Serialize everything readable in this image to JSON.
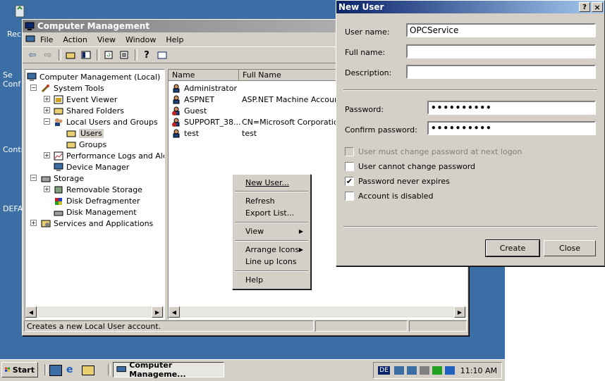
{
  "desktop": {
    "icons": [
      "Rec",
      "Se Conf",
      "Contr",
      "DEFA"
    ]
  },
  "cm_window": {
    "title": "Computer Management",
    "menus": [
      "File",
      "Action",
      "View",
      "Window",
      "Help"
    ],
    "tree": [
      {
        "label": "Computer Management (Local)"
      },
      {
        "label": "System Tools"
      },
      {
        "label": "Event Viewer"
      },
      {
        "label": "Shared Folders"
      },
      {
        "label": "Local Users and Groups"
      },
      {
        "label": "Users"
      },
      {
        "label": "Groups"
      },
      {
        "label": "Performance Logs and Alerts"
      },
      {
        "label": "Device Manager"
      },
      {
        "label": "Storage"
      },
      {
        "label": "Removable Storage"
      },
      {
        "label": "Disk Defragmenter"
      },
      {
        "label": "Disk Management"
      },
      {
        "label": "Services and Applications"
      }
    ],
    "columns": [
      "Name",
      "Full Name"
    ],
    "rows": [
      {
        "name": "Administrator",
        "full": ""
      },
      {
        "name": "ASPNET",
        "full": "ASP.NET Machine Account"
      },
      {
        "name": "Guest",
        "full": ""
      },
      {
        "name": "SUPPORT_38...",
        "full": "CN=Microsoft Corporation..."
      },
      {
        "name": "test",
        "full": "test"
      }
    ],
    "status": "Creates a new Local User account."
  },
  "context_menu": {
    "items": [
      "New User...",
      "Refresh",
      "Export List...",
      "View",
      "Arrange Icons",
      "Line up Icons",
      "Help"
    ]
  },
  "dialog": {
    "title": "New User",
    "help_btn": "?",
    "close_btn": "×",
    "username_label": "User name:",
    "username_value": "OPCService",
    "fullname_label": "Full name:",
    "fullname_value": "",
    "description_label": "Description:",
    "description_value": "",
    "password_label": "Password:",
    "password_value": "••••••••••",
    "confirm_label": "Confirm password:",
    "confirm_value": "••••••••••",
    "checkboxes": [
      {
        "label": "User must change password at next logon",
        "checked": false,
        "disabled": true
      },
      {
        "label": "User cannot change password",
        "checked": false,
        "disabled": false
      },
      {
        "label": "Password never expires",
        "checked": true,
        "disabled": false
      },
      {
        "label": "Account is disabled",
        "checked": false,
        "disabled": false
      }
    ],
    "create_label": "Create",
    "close_label": "Close"
  },
  "taskbar": {
    "start": "Start",
    "task": "Computer Manageme...",
    "clock": "11:10 AM",
    "tray_badge": "DE"
  }
}
